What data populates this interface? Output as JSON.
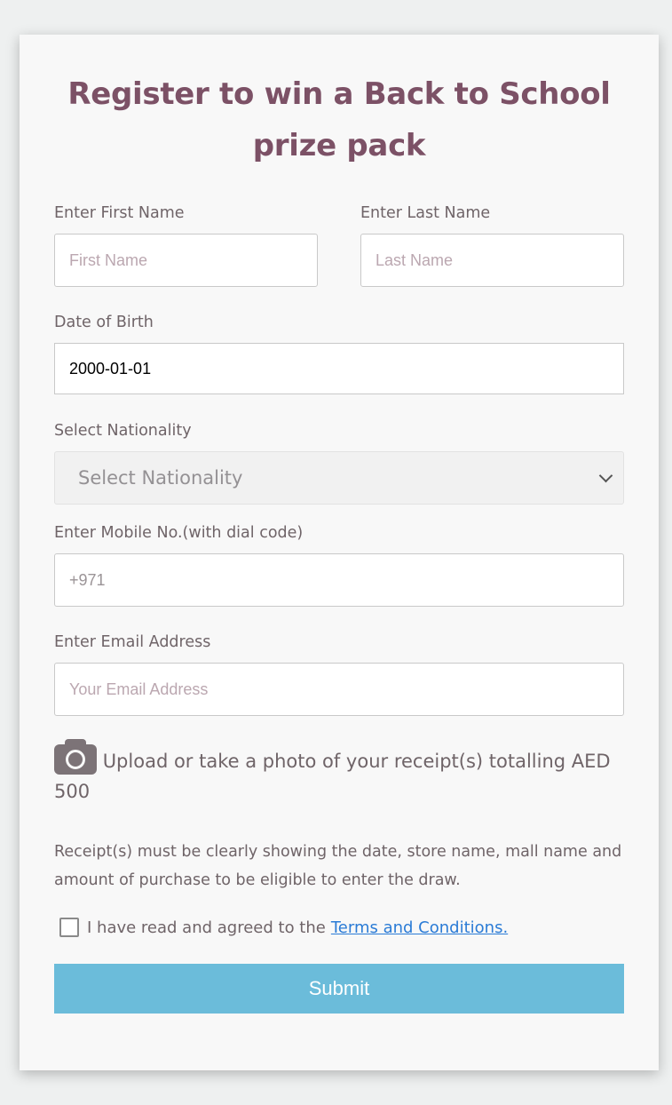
{
  "form": {
    "title": "Register to win a Back to School prize pack",
    "first_name": {
      "label": "Enter First Name",
      "placeholder": "First Name"
    },
    "last_name": {
      "label": "Enter Last Name",
      "placeholder": "Last Name"
    },
    "dob": {
      "label": "Date of Birth",
      "value": "2000-01-01"
    },
    "nationality": {
      "label": "Select Nationality",
      "selected": "Select Nationality"
    },
    "mobile": {
      "label": "Enter Mobile No.(with dial code)",
      "placeholder": "+971"
    },
    "email": {
      "label": "Enter Email Address",
      "placeholder": "Your Email Address"
    },
    "upload": {
      "icon": "camera-icon",
      "text": "Upload or take a photo of your receipt(s) totalling AED 500"
    },
    "note": "Receipt(s) must be clearly showing the date, store name, mall name and amount of purchase to be eligible to enter the draw.",
    "agree": {
      "text": "I have read and agreed to the",
      "link": "Terms and Conditions."
    },
    "submit_label": "Submit"
  },
  "colors": {
    "title": "#7c5166",
    "label": "#6f6468",
    "submit_bg": "#6bbcda",
    "link": "#2a7bd6"
  }
}
